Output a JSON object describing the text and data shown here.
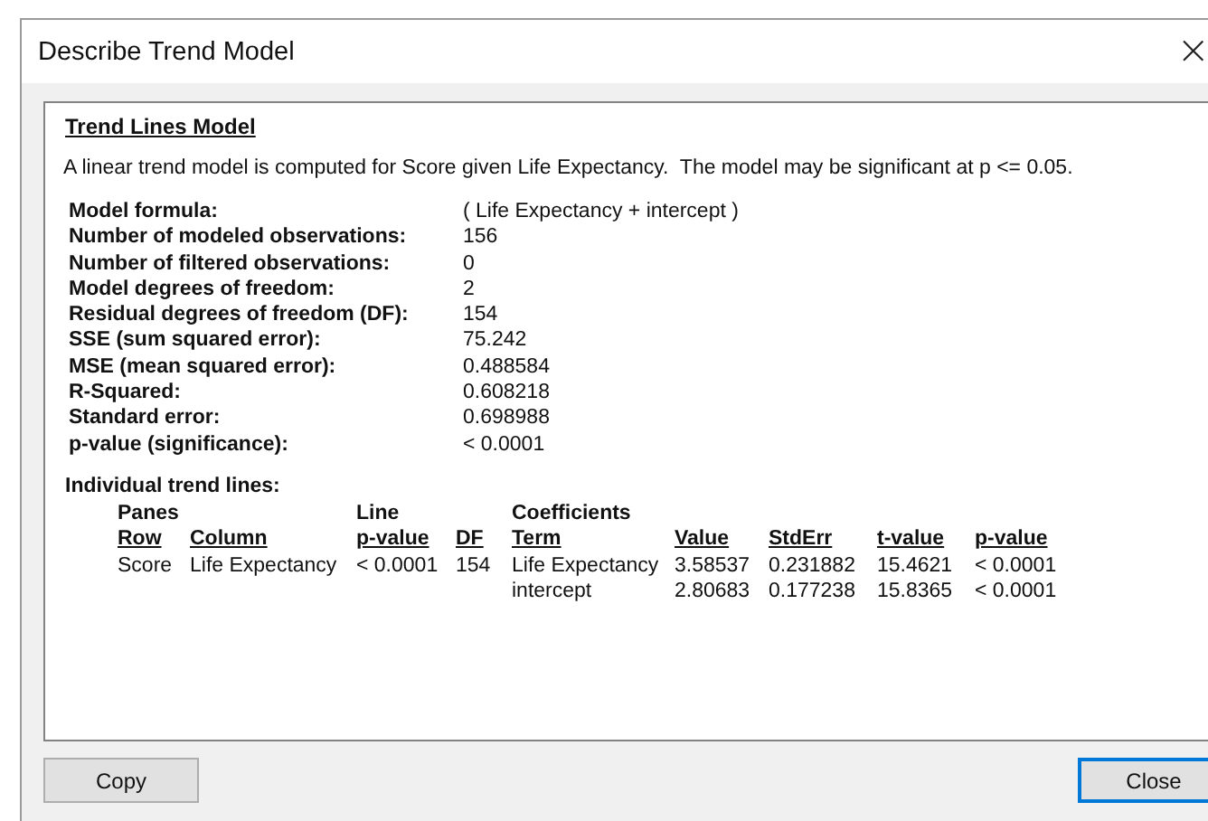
{
  "window": {
    "title": "Describe Trend Model",
    "close_glyph": "×"
  },
  "report": {
    "heading": "Trend Lines Model",
    "summary": "A linear trend model is computed for Score given Life Expectancy.  The model may be significant at p <= 0.05.",
    "stats": [
      {
        "label": "Model formula:",
        "value": "( Life Expectancy + intercept )"
      },
      {
        "label": "Number of modeled observations:",
        "value": "156"
      },
      {
        "label": "Number of filtered observations:",
        "value": "0"
      },
      {
        "label": "Model degrees of freedom:",
        "value": "2"
      },
      {
        "label": "Residual degrees of freedom (DF):",
        "value": "154"
      },
      {
        "label": "SSE (sum squared error):",
        "value": "75.242"
      },
      {
        "label": "MSE (mean squared error):",
        "value": "0.488584"
      },
      {
        "label": "R-Squared:",
        "value": "0.608218"
      },
      {
        "label": "Standard error:",
        "value": "0.698988"
      },
      {
        "label": "p-value (significance):",
        "value": "< 0.0001"
      }
    ],
    "trend_lines": {
      "heading": "Individual trend lines:",
      "columns": [
        {
          "label": "Row",
          "group": "Panes"
        },
        {
          "label": "Column"
        },
        {
          "label": "p-value",
          "group": "Line"
        },
        {
          "label": "DF"
        },
        {
          "label": "Term",
          "group": "Coefficients"
        },
        {
          "label": "Value"
        },
        {
          "label": "StdErr"
        },
        {
          "label": "t-value"
        },
        {
          "label": "p-value"
        }
      ],
      "lines": [
        {
          "row": "Score",
          "column": "Life Expectancy",
          "p_value": "< 0.0001",
          "df": "154",
          "terms": [
            {
              "term": "Life Expectancy",
              "value": "3.58537",
              "stderr": "0.231882",
              "t_value": "15.4621",
              "p_value": "< 0.0001"
            },
            {
              "term": "intercept",
              "value": "2.80683",
              "stderr": "0.177238",
              "t_value": "15.8365",
              "p_value": "< 0.0001"
            }
          ]
        }
      ]
    }
  },
  "buttons": [
    {
      "label": "Copy",
      "default": false
    },
    {
      "label": "Close",
      "default": true
    }
  ]
}
